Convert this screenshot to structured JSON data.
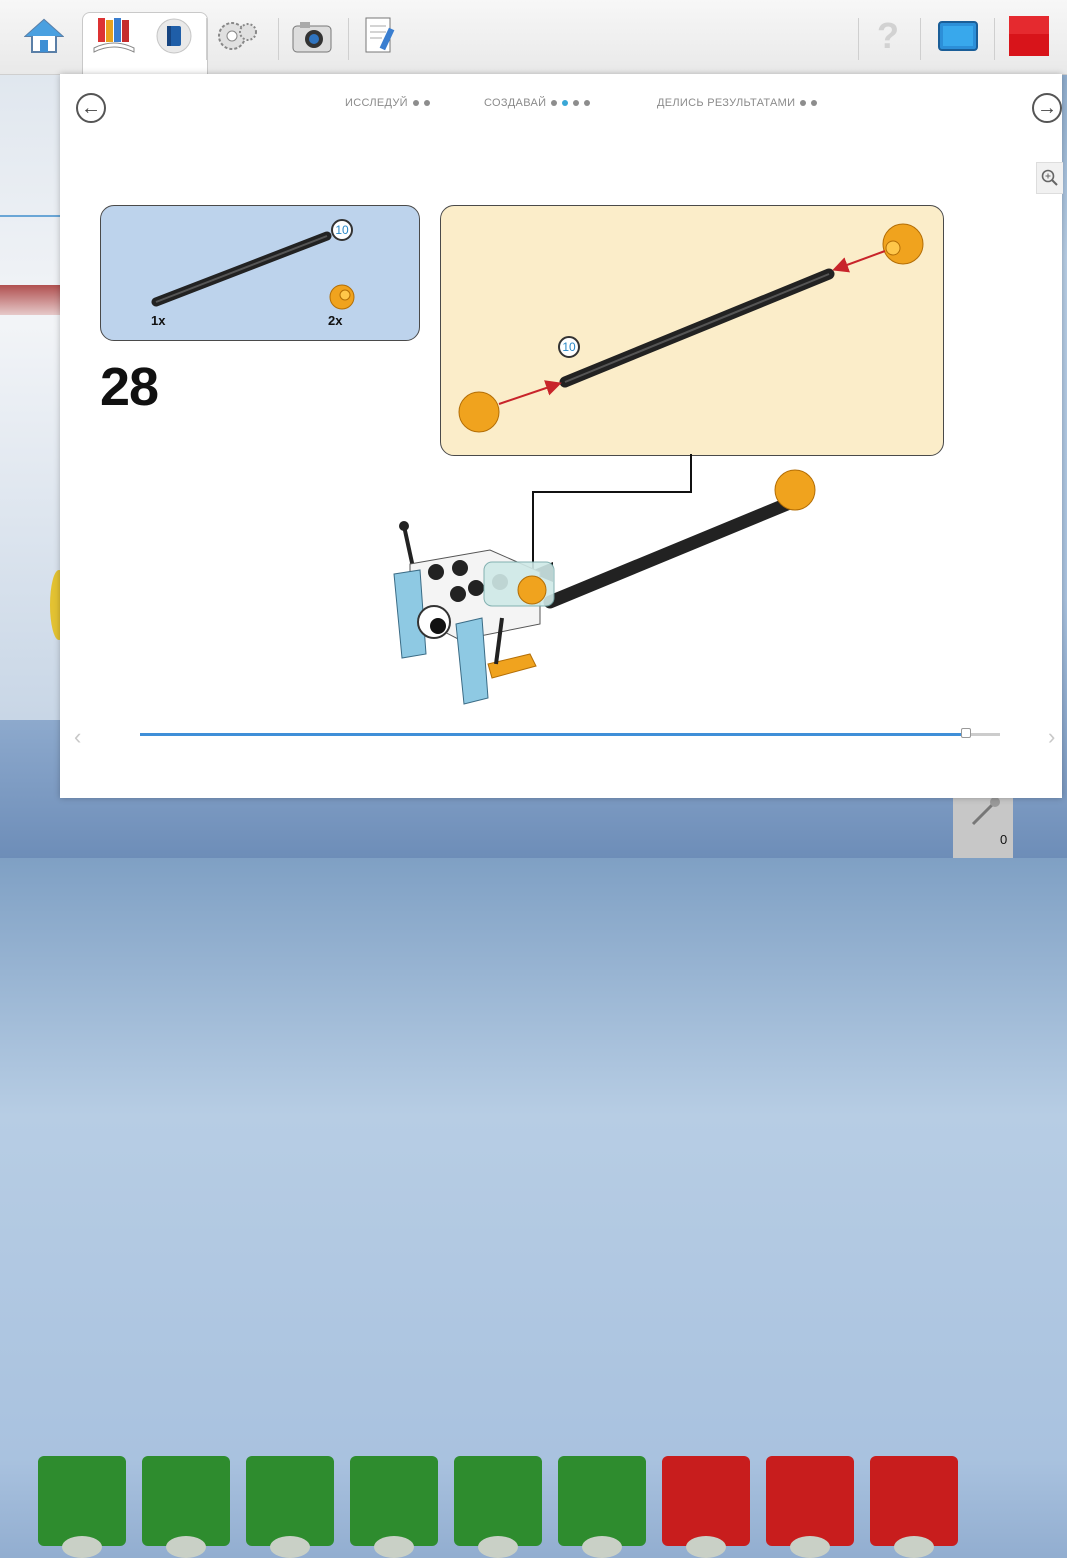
{
  "toolbar": {
    "tabs": [
      {
        "icon": "home-icon"
      },
      {
        "icon": "books-icon",
        "active": true
      },
      {
        "icon": "gear-icon"
      },
      {
        "icon": "camera-icon"
      },
      {
        "icon": "document-pencil-icon"
      }
    ],
    "right": [
      {
        "icon": "help-icon",
        "label": "?"
      },
      {
        "icon": "screen-icon"
      },
      {
        "icon": "stop-icon"
      }
    ]
  },
  "steps": [
    {
      "label": "ИССЛЕДУЙ",
      "dots": [
        false,
        false
      ]
    },
    {
      "label": "СОЗДАВАЙ",
      "dots": [
        false,
        true,
        false,
        false
      ]
    },
    {
      "label": "ДЕЛИСЬ РЕЗУЛЬТАТАМИ",
      "dots": [
        false,
        false
      ]
    }
  ],
  "instruction": {
    "step_number": "28",
    "parts": [
      {
        "name": "axle",
        "length_callout": "10",
        "qty": "1x"
      },
      {
        "name": "yellow-ball",
        "qty": "2x"
      }
    ],
    "assembly_callout": "10"
  },
  "slider": {
    "progress": 0.96
  },
  "counter": {
    "value": "0"
  },
  "colors": {
    "accent": "#3f8fd8",
    "parts_bg": "#bdd3ec",
    "assembly_bg": "#fbedc9",
    "stop": "#d8141a"
  }
}
